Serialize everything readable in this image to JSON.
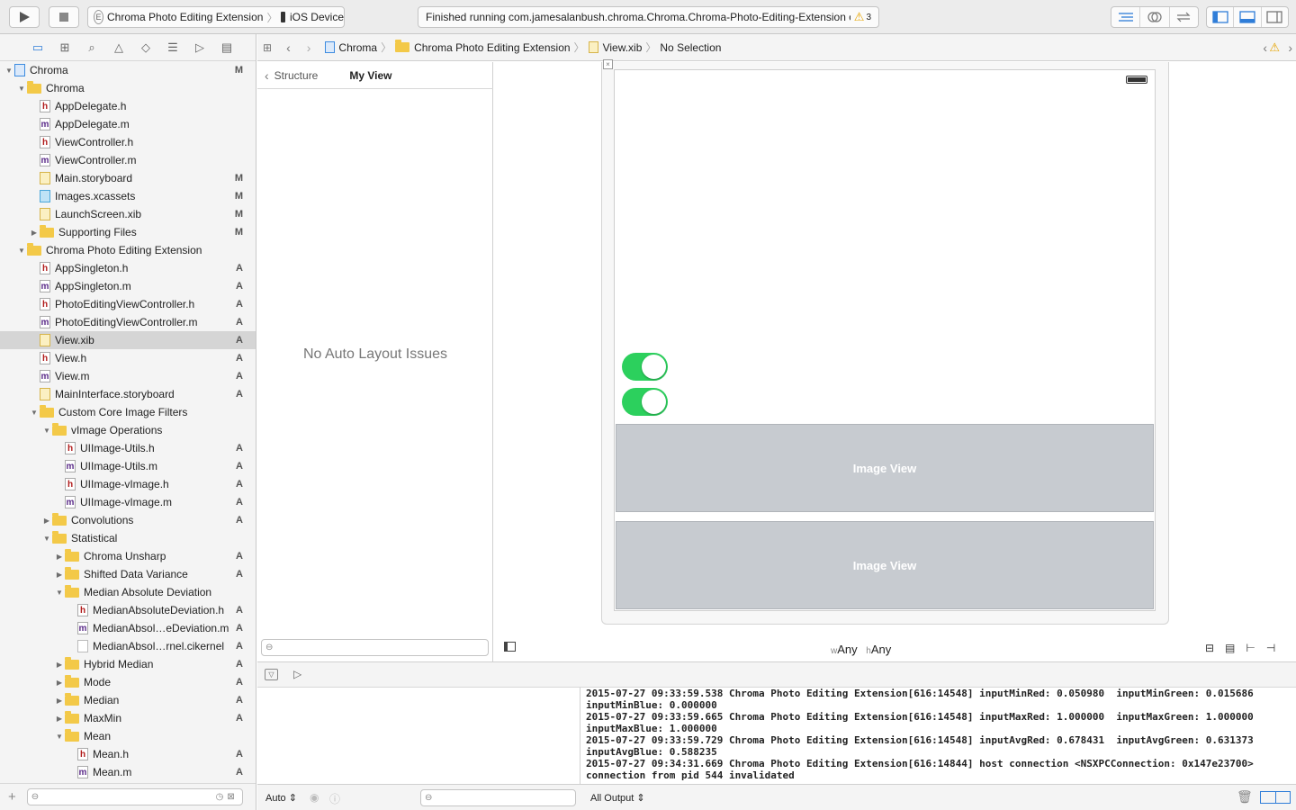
{
  "toolbar": {
    "scheme_target": "Chroma Photo Editing Extension",
    "scheme_device": "iOS Device",
    "activity_text": "Finished running com.jamesalanbush.chroma.Chroma.Chroma-Photo-Editing-Extension on",
    "warning_count": "3"
  },
  "navigator": {
    "items": [
      {
        "label": "Chroma",
        "level": 0,
        "type": "proj",
        "expanded": true,
        "status": "M"
      },
      {
        "label": "Chroma",
        "level": 1,
        "type": "folder",
        "expanded": true,
        "status": ""
      },
      {
        "label": "AppDelegate.h",
        "level": 2,
        "type": "h",
        "status": ""
      },
      {
        "label": "AppDelegate.m",
        "level": 2,
        "type": "m",
        "status": ""
      },
      {
        "label": "ViewController.h",
        "level": 2,
        "type": "h",
        "status": ""
      },
      {
        "label": "ViewController.m",
        "level": 2,
        "type": "m",
        "status": ""
      },
      {
        "label": "Main.storyboard",
        "level": 2,
        "type": "xib",
        "status": "M"
      },
      {
        "label": "Images.xcassets",
        "level": 2,
        "type": "xcassets",
        "status": "M"
      },
      {
        "label": "LaunchScreen.xib",
        "level": 2,
        "type": "xib",
        "status": "M"
      },
      {
        "label": "Supporting Files",
        "level": 2,
        "type": "folder",
        "expanded": false,
        "status": "M"
      },
      {
        "label": "Chroma Photo Editing Extension",
        "level": 1,
        "type": "folder",
        "expanded": true,
        "status": ""
      },
      {
        "label": "AppSingleton.h",
        "level": 2,
        "type": "h",
        "status": "A"
      },
      {
        "label": "AppSingleton.m",
        "level": 2,
        "type": "m",
        "status": "A"
      },
      {
        "label": "PhotoEditingViewController.h",
        "level": 2,
        "type": "h",
        "status": "A"
      },
      {
        "label": "PhotoEditingViewController.m",
        "level": 2,
        "type": "m",
        "status": "A"
      },
      {
        "label": "View.xib",
        "level": 2,
        "type": "xib",
        "status": "A",
        "selected": true
      },
      {
        "label": "View.h",
        "level": 2,
        "type": "h",
        "status": "A"
      },
      {
        "label": "View.m",
        "level": 2,
        "type": "m",
        "status": "A"
      },
      {
        "label": "MainInterface.storyboard",
        "level": 2,
        "type": "xib",
        "status": "A"
      },
      {
        "label": "Custom Core Image Filters",
        "level": 2,
        "type": "folder",
        "expanded": true,
        "status": ""
      },
      {
        "label": "vImage Operations",
        "level": 3,
        "type": "folder",
        "expanded": true,
        "status": ""
      },
      {
        "label": "UIImage-Utils.h",
        "level": 4,
        "type": "h",
        "status": "A"
      },
      {
        "label": "UIImage-Utils.m",
        "level": 4,
        "type": "m",
        "status": "A"
      },
      {
        "label": "UIImage-vImage.h",
        "level": 4,
        "type": "h",
        "status": "A"
      },
      {
        "label": "UIImage-vImage.m",
        "level": 4,
        "type": "m",
        "status": "A"
      },
      {
        "label": "Convolutions",
        "level": 3,
        "type": "folder",
        "expanded": false,
        "status": "A"
      },
      {
        "label": "Statistical",
        "level": 3,
        "type": "folder",
        "expanded": true,
        "status": ""
      },
      {
        "label": "Chroma Unsharp",
        "level": 4,
        "type": "folder",
        "expanded": false,
        "status": "A"
      },
      {
        "label": "Shifted Data Variance",
        "level": 4,
        "type": "folder",
        "expanded": false,
        "status": "A"
      },
      {
        "label": "Median Absolute Deviation",
        "level": 4,
        "type": "folder",
        "expanded": true,
        "status": ""
      },
      {
        "label": "MedianAbsoluteDeviation.h",
        "level": 5,
        "type": "h",
        "status": "A"
      },
      {
        "label": "MedianAbsol…eDeviation.m",
        "level": 5,
        "type": "m",
        "status": "A"
      },
      {
        "label": "MedianAbsol…rnel.cikernel",
        "level": 5,
        "type": "plain",
        "status": "A"
      },
      {
        "label": "Hybrid Median",
        "level": 4,
        "type": "folder",
        "expanded": false,
        "status": "A"
      },
      {
        "label": "Mode",
        "level": 4,
        "type": "folder",
        "expanded": false,
        "status": "A"
      },
      {
        "label": "Median",
        "level": 4,
        "type": "folder",
        "expanded": false,
        "status": "A"
      },
      {
        "label": "MaxMin",
        "level": 4,
        "type": "folder",
        "expanded": false,
        "status": "A"
      },
      {
        "label": "Mean",
        "level": 4,
        "type": "folder",
        "expanded": true,
        "status": ""
      },
      {
        "label": "Mean.h",
        "level": 5,
        "type": "h",
        "status": "A"
      },
      {
        "label": "Mean.m",
        "level": 5,
        "type": "m",
        "status": "A"
      }
    ]
  },
  "jumpbar": {
    "crumbs": [
      "Chroma",
      "Chroma Photo Editing Extension",
      "View.xib",
      "No Selection"
    ]
  },
  "outline": {
    "back_label": "Structure",
    "title": "My View",
    "empty_message": "No Auto Layout Issues"
  },
  "canvas": {
    "image_view_1": "Image View",
    "image_view_2": "Image View",
    "size_w_prefix": "w",
    "size_w": "Any",
    "size_h_prefix": "h",
    "size_h": "Any"
  },
  "debug": {
    "console_lines": [
      "2015-07-27 09:33:59.538 Chroma Photo Editing Extension[616:14548] inputMinRed: 0.050980  inputMinGreen: 0.015686",
      "inputMinBlue: 0.000000",
      "2015-07-27 09:33:59.665 Chroma Photo Editing Extension[616:14548] inputMaxRed: 1.000000  inputMaxGreen: 1.000000",
      "inputMaxBlue: 1.000000",
      "2015-07-27 09:33:59.729 Chroma Photo Editing Extension[616:14548] inputAvgRed: 0.678431  inputAvgGreen: 0.631373",
      "inputAvgBlue: 0.588235",
      "2015-07-27 09:34:31.669 Chroma Photo Editing Extension[616:14844] host connection <NSXPCConnection: 0x147e23700>",
      "connection from pid 544 invalidated"
    ],
    "vars_mode": "Auto",
    "output_mode": "All Output"
  },
  "colors": {
    "switch_on": "#2cd05d",
    "image_view_bg": "#c7cbd0",
    "accent": "#2f7dd8"
  }
}
